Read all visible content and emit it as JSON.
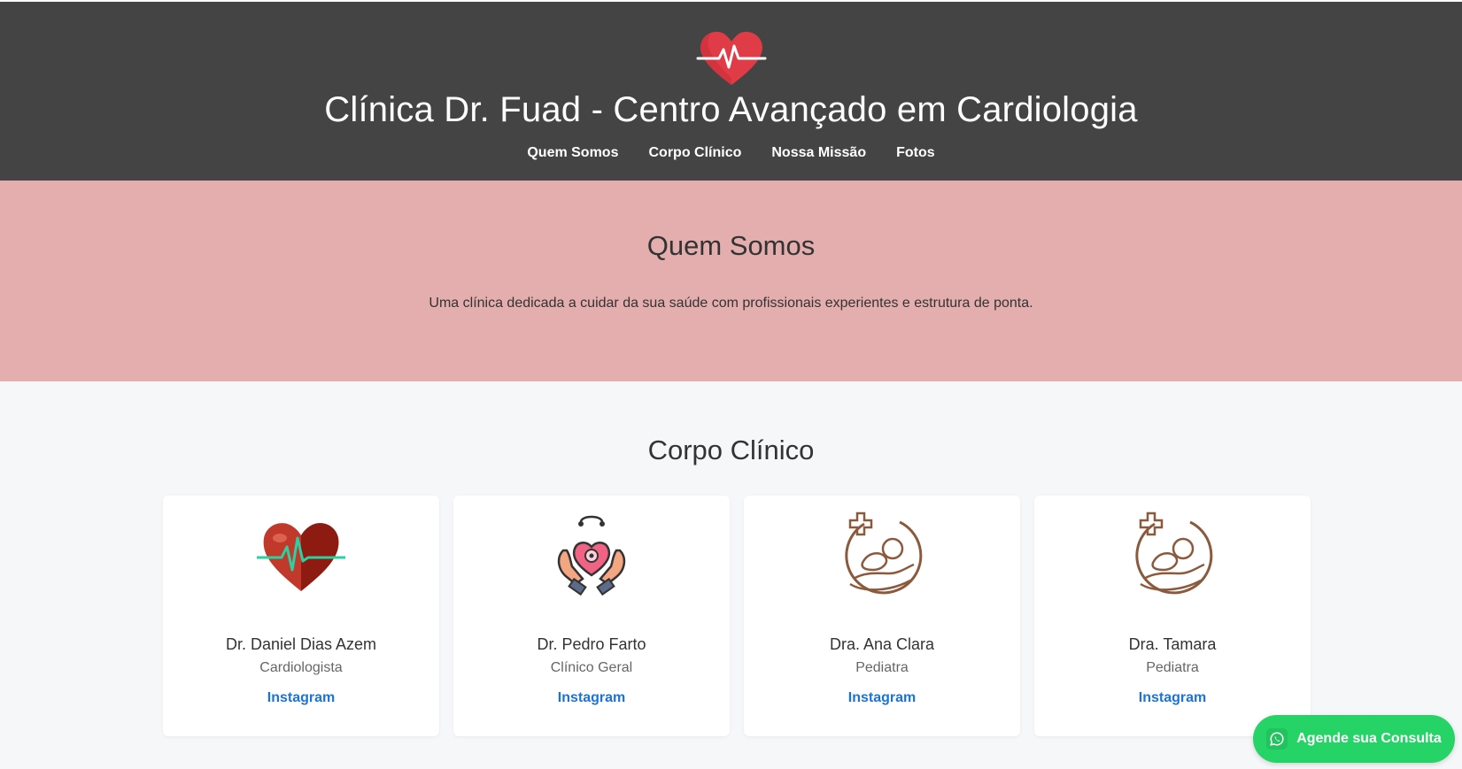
{
  "header": {
    "logo_icon": "heart-pulse-icon",
    "title": "Clínica Dr. Fuad - Centro Avançado em Cardiologia",
    "nav": [
      {
        "label": "Quem Somos"
      },
      {
        "label": "Corpo Clínico"
      },
      {
        "label": "Nossa Missão"
      },
      {
        "label": "Fotos"
      }
    ]
  },
  "about": {
    "title": "Quem Somos",
    "text": "Uma clínica dedicada a cuidar da sua saúde com profissionais experientes e estrutura de ponta."
  },
  "team": {
    "title": "Corpo Clínico",
    "doctors": [
      {
        "name": "Dr. Daniel Dias Azem",
        "role": "Cardiologista",
        "link": "Instagram",
        "icon": "heart-ecg-icon"
      },
      {
        "name": "Dr. Pedro Farto",
        "role": "Clínico Geral",
        "link": "Instagram",
        "icon": "hands-heart-stethoscope-icon"
      },
      {
        "name": "Dra. Ana Clara",
        "role": "Pediatra",
        "link": "Instagram",
        "icon": "baby-care-icon"
      },
      {
        "name": "Dra. Tamara",
        "role": "Pediatra",
        "link": "Instagram",
        "icon": "baby-care-icon"
      }
    ]
  },
  "cta": {
    "label": "Agende sua Consulta",
    "icon": "whatsapp-icon"
  },
  "colors": {
    "header_bg": "#444444",
    "about_bg": "#e5aeae",
    "page_bg": "#f6f7f9",
    "link": "#1a73d9",
    "whatsapp": "#25d366"
  }
}
